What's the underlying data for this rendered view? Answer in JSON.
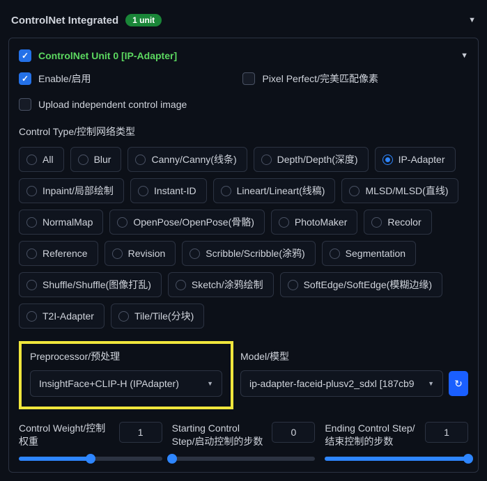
{
  "header": {
    "title": "ControlNet Integrated",
    "badge": "1 unit"
  },
  "unit": {
    "title": "ControlNet Unit 0 [IP-Adapter]",
    "enable_label": "Enable/启用",
    "pixel_perfect_label": "Pixel Perfect/完美匹配像素",
    "upload_label": "Upload independent control image"
  },
  "controlType": {
    "label": "Control Type/控制网络类型",
    "options": [
      "All",
      "Blur",
      "Canny/Canny(线条)",
      "Depth/Depth(深度)",
      "IP-Adapter",
      "Inpaint/局部绘制",
      "Instant-ID",
      "Lineart/Lineart(线稿)",
      "MLSD/MLSD(直线)",
      "NormalMap",
      "OpenPose/OpenPose(骨骼)",
      "PhotoMaker",
      "Recolor",
      "Reference",
      "Revision",
      "Scribble/Scribble(涂鸦)",
      "Segmentation",
      "Shuffle/Shuffle(图像打乱)",
      "Sketch/涂鸦绘制",
      "SoftEdge/SoftEdge(模糊边缘)",
      "T2I-Adapter",
      "Tile/Tile(分块)"
    ],
    "selected": "IP-Adapter"
  },
  "preprocessor": {
    "label": "Preprocessor/预处理",
    "value": "InsightFace+CLIP-H (IPAdapter)"
  },
  "model": {
    "label": "Model/模型",
    "value": "ip-adapter-faceid-plusv2_sdxl [187cb9"
  },
  "sliders": {
    "weight": {
      "label": "Control Weight/控制权重",
      "value": "1",
      "fill": 50
    },
    "start": {
      "label": "Starting Control Step/启动控制的步数",
      "value": "0",
      "fill": 0
    },
    "end": {
      "label": "Ending Control Step/结束控制的步数",
      "value": "1",
      "fill": 100
    }
  }
}
